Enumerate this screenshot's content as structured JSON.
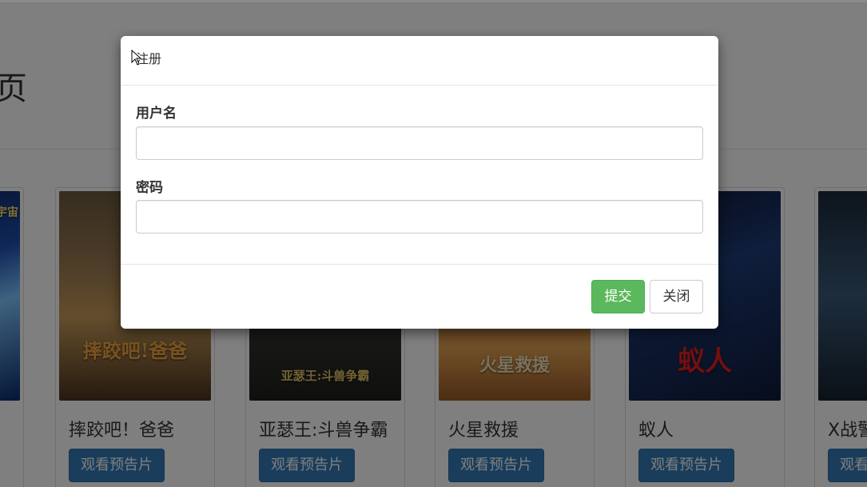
{
  "page": {
    "heading": "页"
  },
  "movies": [
    {
      "title": "",
      "button": "",
      "poster_text": "宇宙"
    },
    {
      "title": "摔跤吧！爸爸",
      "button": "观看预告片",
      "poster_text": "摔跤吧!爸爸"
    },
    {
      "title": "亚瑟王:斗兽争霸",
      "button": "观看预告片",
      "poster_text": "亚瑟王:斗兽争霸"
    },
    {
      "title": "火星救援",
      "button": "观看预告片",
      "poster_text": "火星救援"
    },
    {
      "title": "蚁人",
      "button": "观看预告片",
      "poster_text": "蚁人"
    },
    {
      "title": "X战警",
      "button": "观看预告片",
      "poster_text": ""
    }
  ],
  "modal": {
    "title": "注册",
    "username_label": "用户名",
    "username_value": "",
    "password_label": "密码",
    "password_value": "",
    "submit_label": "提交",
    "close_label": "关闭"
  },
  "colors": {
    "primary": "#337ab7",
    "success": "#5cb85c",
    "backdrop": "rgba(0,0,0,0.5)"
  }
}
